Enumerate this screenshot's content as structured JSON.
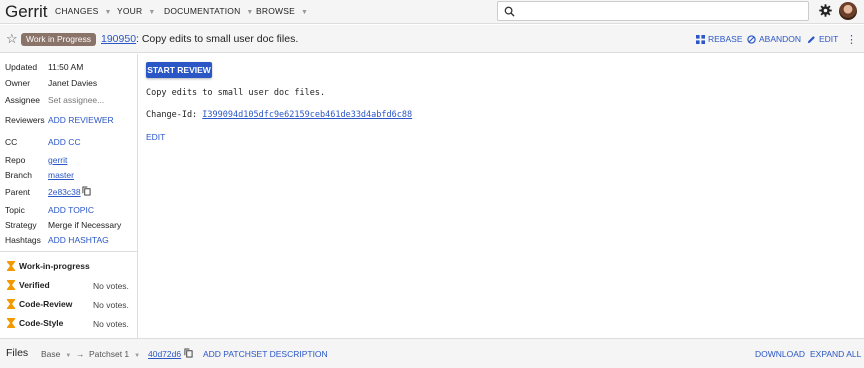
{
  "topbar": {
    "logo": "Gerrit",
    "nav": [
      "CHANGES",
      "YOUR",
      "DOCUMENTATION",
      "BROWSE"
    ],
    "caret": "▼"
  },
  "header": {
    "status_badge": "Work in Progress",
    "change_number": "190950",
    "change_title": ": Copy edits to small user doc files.",
    "actions": {
      "rebase": "REBASE",
      "abandon": "ABANDON",
      "edit": "EDIT"
    },
    "more": "⋮"
  },
  "sidebar": {
    "updated_label": "Updated",
    "updated_value": "11:50 AM",
    "owner_label": "Owner",
    "owner_value": "Janet Davies",
    "assignee_label": "Assignee",
    "assignee_value": "Set assignee...",
    "reviewers_label": "Reviewers",
    "reviewers_value": "ADD REVIEWER",
    "cc_label": "CC",
    "cc_value": "ADD CC",
    "repo_label": "Repo",
    "repo_value": "gerrit",
    "branch_label": "Branch",
    "branch_value": "master",
    "parent_label": "Parent",
    "parent_value": "2e83c38",
    "topic_label": "Topic",
    "topic_value": "ADD TOPIC",
    "strategy_label": "Strategy",
    "strategy_value": "Merge if Necessary",
    "hashtags_label": "Hashtags",
    "hashtags_value": "ADD HASHTAG",
    "labels": [
      {
        "name": "Work-in-progress",
        "votes": ""
      },
      {
        "name": "Verified",
        "votes": "No votes."
      },
      {
        "name": "Code-Review",
        "votes": "No votes."
      },
      {
        "name": "Code-Style",
        "votes": "No votes."
      }
    ]
  },
  "main": {
    "start_review": "START REVIEW",
    "commit_message": "Copy edits to small user doc files.",
    "change_id_label": "Change-Id: ",
    "change_id_value": "I399094d105dfc9e62159ceb461de33d4abfd6c88",
    "edit": "EDIT"
  },
  "filesbar": {
    "files": "Files",
    "base": "Base",
    "arrow": "→",
    "patchset": "Patchset 1",
    "commit": "40d72d6",
    "add_description": "ADD PATCHSET DESCRIPTION",
    "download": "DOWNLOAD",
    "expand_all": "EXPAND ALL"
  },
  "colors": {
    "accent": "#2a56c6",
    "badge": "#8a7369",
    "hourglass": "#f29900"
  }
}
